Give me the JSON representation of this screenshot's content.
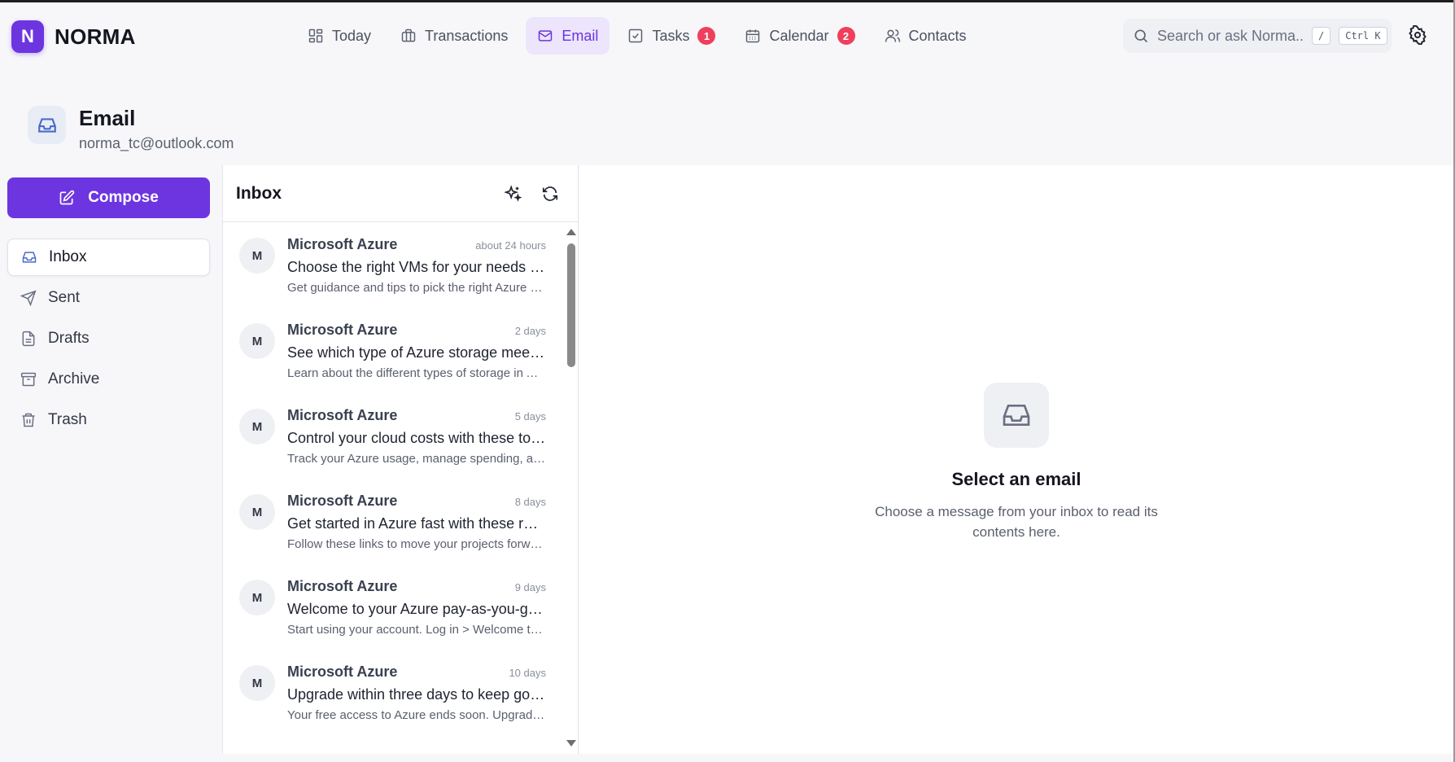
{
  "app": {
    "logo_letter": "N",
    "name": "NORMA",
    "accent": "#6d35e0",
    "badge_color": "#ef3f5c"
  },
  "nav": [
    {
      "label": "Today",
      "icon": "dashboard-icon"
    },
    {
      "label": "Transactions",
      "icon": "wallet-icon"
    },
    {
      "label": "Email",
      "icon": "mail-icon",
      "active": true
    },
    {
      "label": "Tasks",
      "icon": "checkbox-icon",
      "badge": "1"
    },
    {
      "label": "Calendar",
      "icon": "calendar-icon",
      "badge": "2"
    },
    {
      "label": "Contacts",
      "icon": "users-icon"
    }
  ],
  "search": {
    "placeholder": "Search or ask Norma...",
    "shortcut_slash": "/",
    "shortcut_ctrl": "Ctrl K"
  },
  "page": {
    "title": "Email",
    "account": "norma_tc@outlook.com"
  },
  "sidebar": {
    "compose_label": "Compose",
    "folders": [
      {
        "label": "Inbox",
        "icon": "inbox-icon",
        "active": true
      },
      {
        "label": "Sent",
        "icon": "send-icon"
      },
      {
        "label": "Drafts",
        "icon": "file-icon"
      },
      {
        "label": "Archive",
        "icon": "archive-icon"
      },
      {
        "label": "Trash",
        "icon": "trash-icon"
      }
    ]
  },
  "inbox": {
    "title": "Inbox",
    "emails": [
      {
        "avatar": "M",
        "sender": "Microsoft Azure",
        "time": "about 24 hours",
        "subject": "Choose the right VMs for your needs and workloads",
        "preview": "Get guidance and tips to pick the right Azure virtual machines"
      },
      {
        "avatar": "M",
        "sender": "Microsoft Azure",
        "time": "2 days",
        "subject": "See which type of Azure storage meets your needs",
        "preview": "Learn about the different types of storage in Azure"
      },
      {
        "avatar": "M",
        "sender": "Microsoft Azure",
        "time": "5 days",
        "subject": "Control your cloud costs with these tools",
        "preview": "Track your Azure usage, manage spending, and more"
      },
      {
        "avatar": "M",
        "sender": "Microsoft Azure",
        "time": "8 days",
        "subject": "Get started in Azure fast with these resources",
        "preview": "Follow these links to move your projects forward"
      },
      {
        "avatar": "M",
        "sender": "Microsoft Azure",
        "time": "9 days",
        "subject": "Welcome to your Azure pay-as-you-go account",
        "preview": "Start using your account. Log in > Welcome to Azure"
      },
      {
        "avatar": "M",
        "sender": "Microsoft Azure",
        "time": "10 days",
        "subject": "Upgrade within three days to keep going with Azure",
        "preview": "Your free access to Azure ends soon. Upgrade now"
      }
    ]
  },
  "reader": {
    "empty_title": "Select an email",
    "empty_text": "Choose a message from your inbox to read its contents here."
  }
}
